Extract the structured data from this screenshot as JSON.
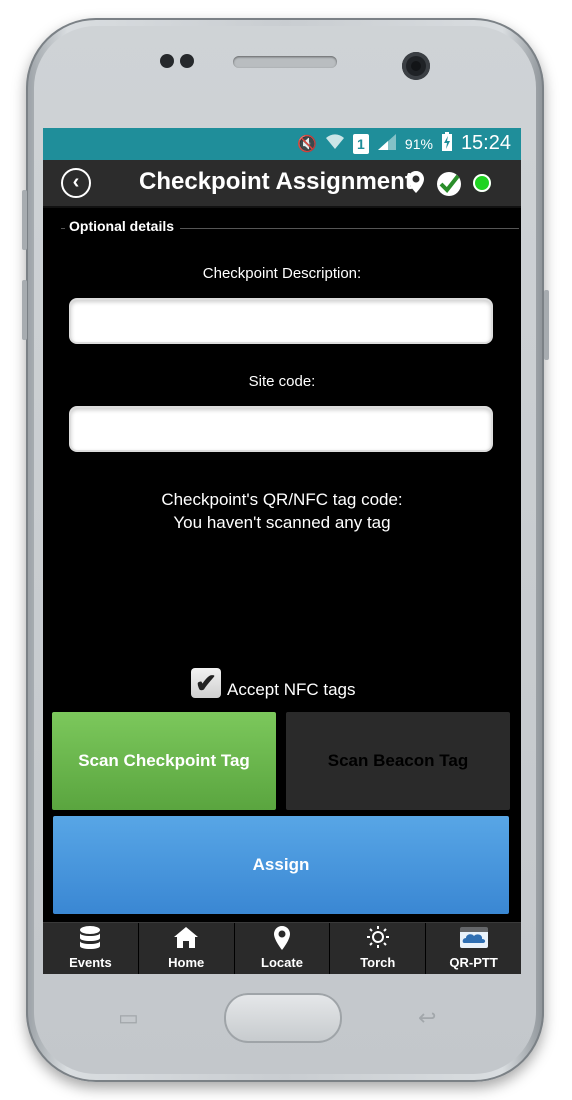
{
  "status_bar": {
    "battery": "91%",
    "time": "15:24",
    "sim_slot": "1",
    "icons": [
      "mute-icon",
      "wifi-icon",
      "sim-icon",
      "signal-icon",
      "battery-charging-icon"
    ]
  },
  "app_bar": {
    "title": "Checkpoint Assignment",
    "back_icon": "back-arrow-icon",
    "status_icons": [
      "location-pin-icon",
      "checkmark-badge-icon",
      "online-status-icon"
    ],
    "online_color": "#1fd321"
  },
  "form": {
    "section_title": "Optional details",
    "description_label": "Checkpoint Description:",
    "description_value": "",
    "site_code_label": "Site code:",
    "site_code_value": "",
    "tag_code_label": "Checkpoint's QR/NFC tag code:",
    "tag_code_value": "You haven't scanned any tag",
    "accept_nfc_label": "Accept NFC tags",
    "accept_nfc_checked": true
  },
  "buttons": {
    "scan_checkpoint": "Scan Checkpoint Tag",
    "scan_beacon": "Scan Beacon Tag",
    "assign": "Assign"
  },
  "bottom_nav": [
    {
      "label": "Events",
      "icon": "database-icon"
    },
    {
      "label": "Home",
      "icon": "home-icon"
    },
    {
      "label": "Locate",
      "icon": "location-pin-icon"
    },
    {
      "label": "Torch",
      "icon": "sun-icon"
    },
    {
      "label": "QR-PTT",
      "icon": "qr-ptt-logo-icon"
    }
  ],
  "colors": {
    "status_bar": "#1f8e9a",
    "scan_checkpoint": "#6bb84d",
    "scan_beacon": "#2a2a2a",
    "assign": "#4a98de"
  }
}
